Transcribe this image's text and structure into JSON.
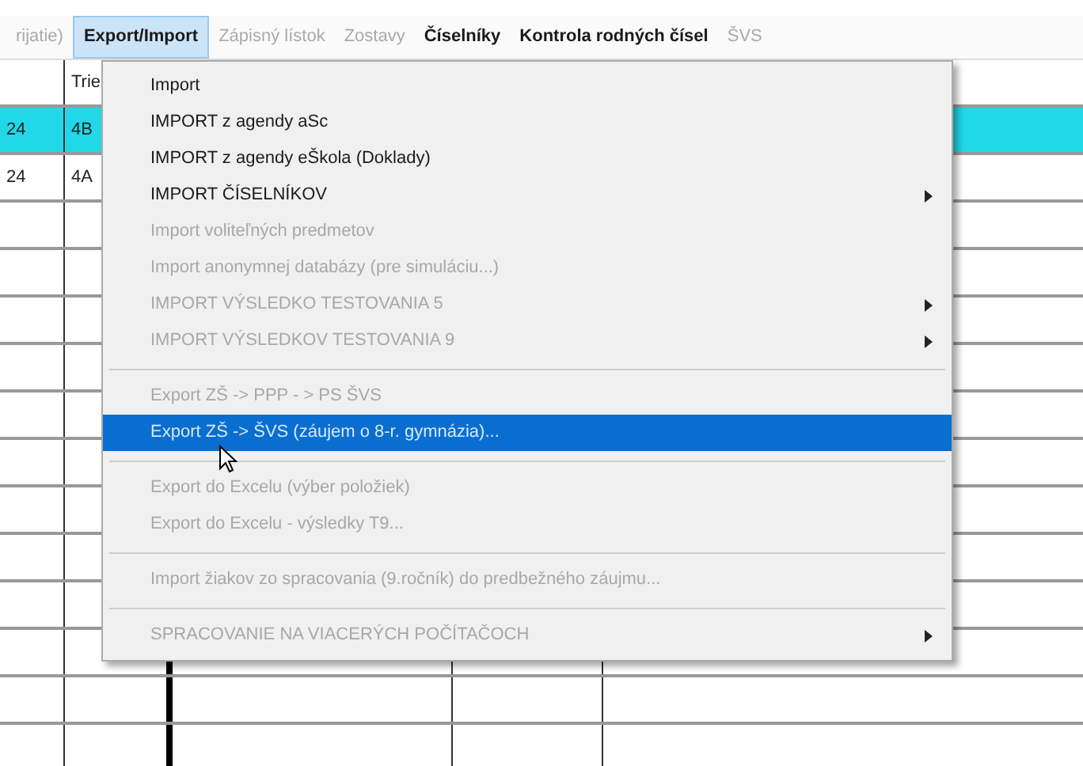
{
  "menubar": [
    {
      "label": "rijatie)",
      "selected": false,
      "disabled": true
    },
    {
      "label": "Export/Import",
      "selected": true,
      "disabled": false
    },
    {
      "label": "Zápisný lístok",
      "selected": false,
      "disabled": true
    },
    {
      "label": "Zostavy",
      "selected": false,
      "disabled": true
    },
    {
      "label": "Číselníky",
      "selected": false,
      "disabled": false
    },
    {
      "label": "Kontrola rodných čísel",
      "selected": false,
      "disabled": false
    },
    {
      "label": "ŠVS",
      "selected": false,
      "disabled": true
    }
  ],
  "grid": {
    "header_column_2": "Trie",
    "rows": [
      {
        "cells": [
          "24",
          "4B"
        ],
        "selected": true
      },
      {
        "cells": [
          "24",
          "4A"
        ],
        "selected": false
      },
      {
        "cells": [],
        "selected": false
      },
      {
        "cells": [],
        "selected": false
      },
      {
        "cells": [],
        "selected": false
      },
      {
        "cells": [],
        "selected": false
      },
      {
        "cells": [],
        "selected": false
      },
      {
        "cells": [],
        "selected": false
      },
      {
        "cells": [],
        "selected": false
      },
      {
        "cells": [],
        "selected": false
      },
      {
        "cells": [],
        "selected": false
      },
      {
        "cells": [],
        "selected": false
      },
      {
        "cells": [],
        "selected": false
      },
      {
        "cells": [],
        "selected": false
      }
    ]
  },
  "menu": [
    {
      "kind": "item",
      "label": "Import",
      "disabled": false,
      "selected": false,
      "submenu": false
    },
    {
      "kind": "item",
      "label": "IMPORT z agendy aSc",
      "disabled": false,
      "selected": false,
      "submenu": false
    },
    {
      "kind": "item",
      "label": "IMPORT z agendy eŠkola (Doklady)",
      "disabled": false,
      "selected": false,
      "submenu": false
    },
    {
      "kind": "item",
      "label": "IMPORT ČÍSELNÍKOV",
      "disabled": false,
      "selected": false,
      "submenu": true
    },
    {
      "kind": "item",
      "label": "Import voliteľných predmetov",
      "disabled": true,
      "selected": false,
      "submenu": false
    },
    {
      "kind": "item",
      "label": "Import anonymnej databázy (pre simuláciu...)",
      "disabled": true,
      "selected": false,
      "submenu": false
    },
    {
      "kind": "item",
      "label": "IMPORT VÝSLEDKO TESTOVANIA 5",
      "disabled": true,
      "selected": false,
      "submenu": true
    },
    {
      "kind": "item",
      "label": "IMPORT VÝSLEDKOV TESTOVANIA 9",
      "disabled": true,
      "selected": false,
      "submenu": true
    },
    {
      "kind": "separator"
    },
    {
      "kind": "item",
      "label": "Export ZŠ -> PPP - > PS ŠVS",
      "disabled": true,
      "selected": false,
      "submenu": false
    },
    {
      "kind": "item",
      "label": "Export ZŠ -> ŠVS (záujem o 8-r. gymnázia)...",
      "disabled": false,
      "selected": true,
      "submenu": false
    },
    {
      "kind": "separator"
    },
    {
      "kind": "item",
      "label": "Export do Excelu (výber položiek)",
      "disabled": true,
      "selected": false,
      "submenu": false
    },
    {
      "kind": "item",
      "label": "Export do Excelu - výsledky T9...",
      "disabled": true,
      "selected": false,
      "submenu": false
    },
    {
      "kind": "separator"
    },
    {
      "kind": "item",
      "label": "Import žiakov zo spracovania (9.ročník) do predbežného záujmu...",
      "disabled": true,
      "selected": false,
      "submenu": false
    },
    {
      "kind": "separator"
    },
    {
      "kind": "item",
      "label": "SPRACOVANIE NA VIACERÝCH POČÍTAČOCH",
      "disabled": true,
      "selected": false,
      "submenu": true
    }
  ]
}
